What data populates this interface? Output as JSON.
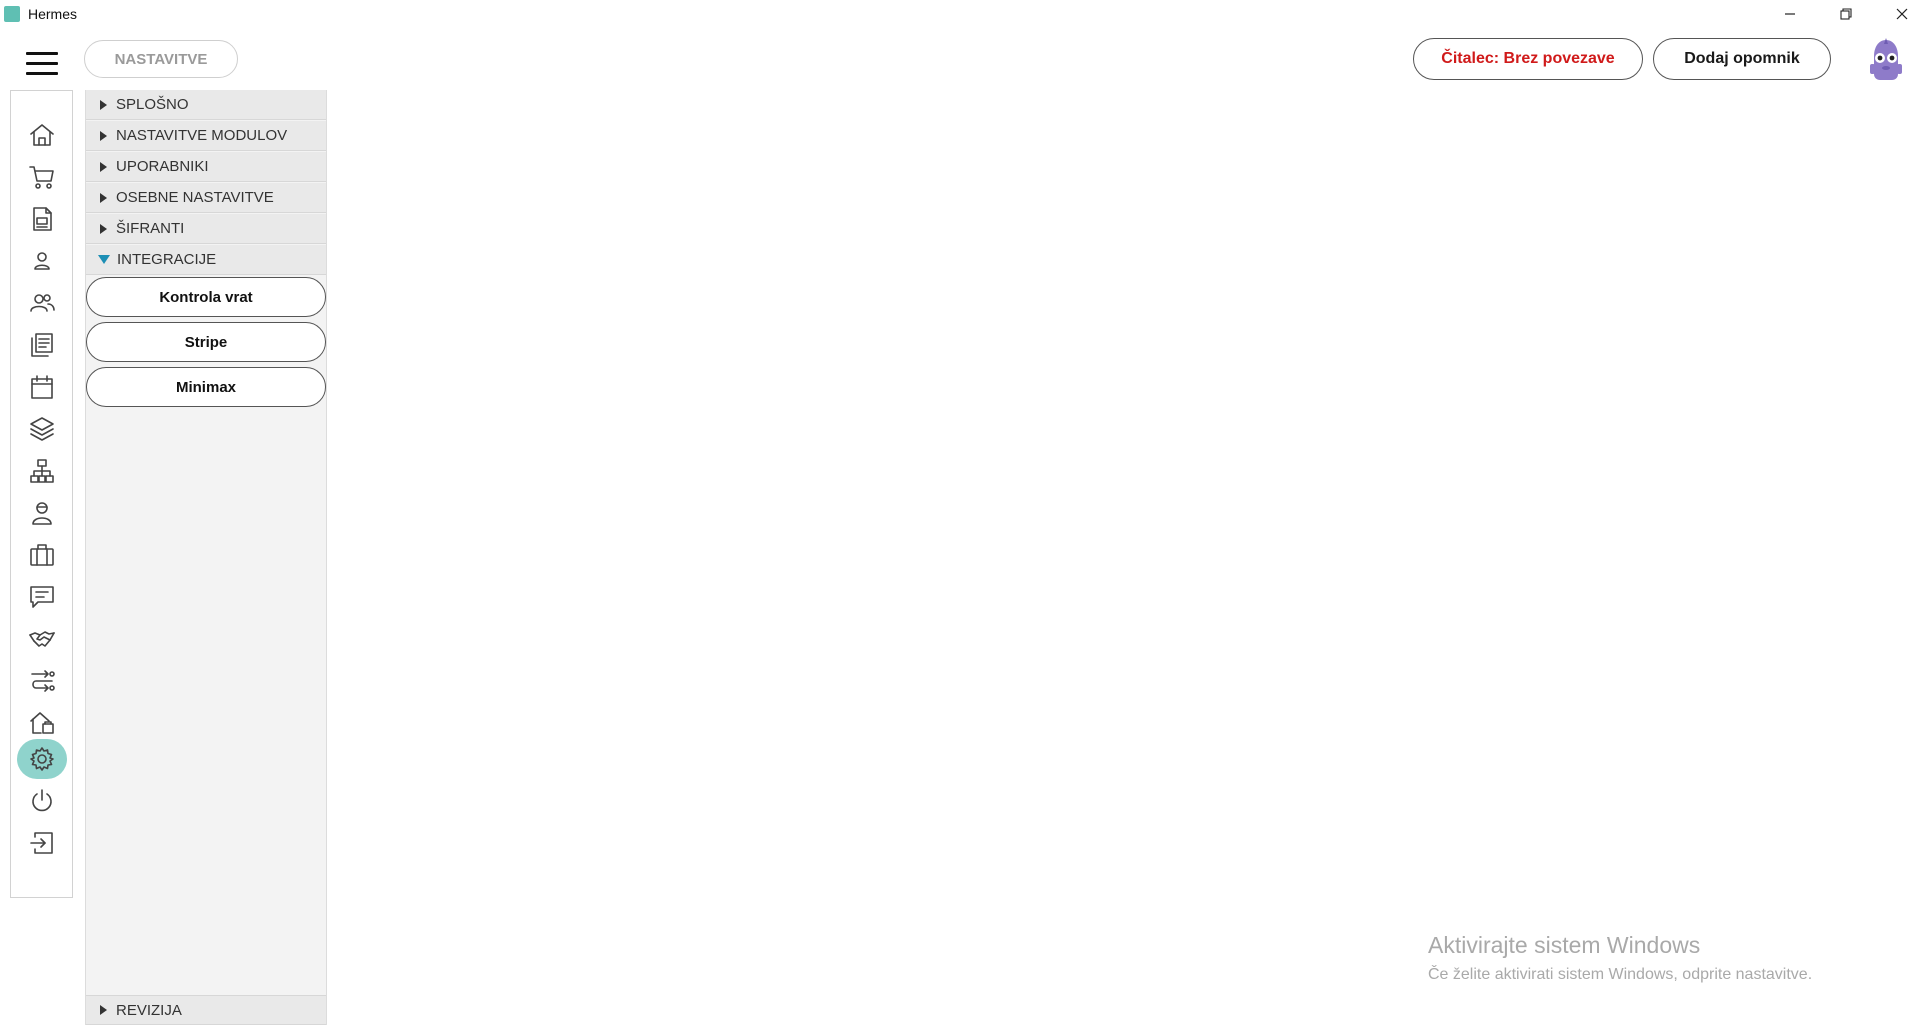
{
  "window": {
    "title": "Hermes",
    "minimize_icon": "minimize-icon",
    "restore_icon": "restore-icon",
    "close_icon": "close-icon"
  },
  "header": {
    "page_title": "NASTAVITVE",
    "reader_button": "Čitalec: Brez povezave",
    "reminder_button": "Dodaj opomnik",
    "reader_color": "#d01a1a"
  },
  "rail": {
    "items": [
      {
        "name": "home-icon"
      },
      {
        "name": "cart-icon"
      },
      {
        "name": "documents-icon"
      },
      {
        "name": "user-icon"
      },
      {
        "name": "users-icon"
      },
      {
        "name": "reports-icon"
      },
      {
        "name": "calendar-icon"
      },
      {
        "name": "layers-icon"
      },
      {
        "name": "hierarchy-icon"
      },
      {
        "name": "employee-icon"
      },
      {
        "name": "briefcase-icon"
      },
      {
        "name": "chat-icon"
      },
      {
        "name": "handshake-icon"
      },
      {
        "name": "route-icon"
      },
      {
        "name": "building-icon"
      },
      {
        "name": "settings-icon",
        "active": true
      },
      {
        "name": "power-icon"
      },
      {
        "name": "logout-icon"
      }
    ],
    "active_color": "#8fd3cc"
  },
  "settings_tree": {
    "sections": [
      {
        "label": "SPLOŠNO",
        "expanded": false
      },
      {
        "label": "NASTAVITVE MODULOV",
        "expanded": false
      },
      {
        "label": "UPORABNIKI",
        "expanded": false
      },
      {
        "label": "OSEBNE NASTAVITVE",
        "expanded": false
      },
      {
        "label": "ŠIFRANTI",
        "expanded": false
      },
      {
        "label": "INTEGRACIJE",
        "expanded": true
      }
    ],
    "integrations": [
      "Kontrola vrat",
      "Stripe",
      "Minimax"
    ],
    "bottom_section": {
      "label": "REVIZIJA",
      "expanded": false
    }
  },
  "watermark": {
    "title": "Aktivirajte sistem Windows",
    "subtitle": "Če želite aktivirati sistem Windows, odprite nastavitve."
  }
}
